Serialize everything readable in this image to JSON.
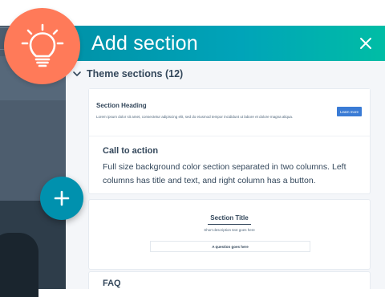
{
  "panel": {
    "title": "Add section",
    "group_label": "Theme sections (12)"
  },
  "cards": [
    {
      "preview_heading": "Section Heading",
      "preview_text": "Lorem ipsum dolor sit amet, consectetur adipiscing elit, sed do eiusmod tempor incididunt ut labore et dolore magna aliqua.",
      "preview_button": "Learn more",
      "title": "Call to action",
      "description": "Full size background color section separated in two columns. Left columns has title and text, and right column has a button."
    },
    {
      "preview_title": "Section Title",
      "preview_subtitle": "Short description text goes here",
      "preview_field": "A question goes here"
    },
    {
      "title": "FAQ"
    }
  ],
  "icons": {
    "bulb": "lightbulb-icon",
    "add": "plus-icon",
    "close": "close-icon",
    "chevron": "chevron-down-icon"
  },
  "colors": {
    "accent_orange": "#ff7a59",
    "header_teal": "#00a4b9",
    "fab_teal": "#0091ae",
    "preview_button_blue": "#3a7bd5"
  }
}
